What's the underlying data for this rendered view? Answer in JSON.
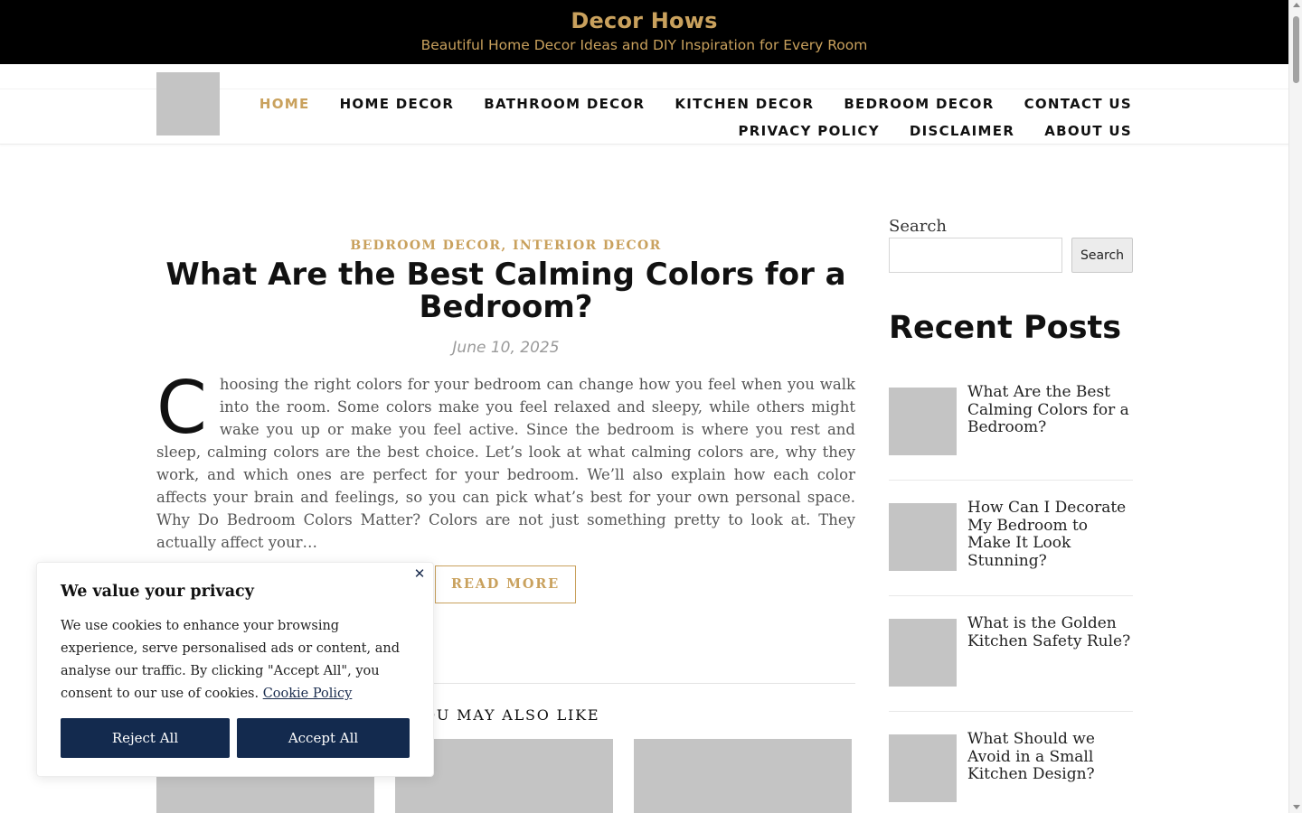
{
  "site": {
    "title": "Decor Hows",
    "tagline": "Beautiful Home Decor Ideas and DIY Inspiration for Every Room"
  },
  "nav": {
    "row1": [
      "HOME",
      "HOME DECOR",
      "BATHROOM DECOR",
      "KITCHEN DECOR",
      "BEDROOM DECOR",
      "CONTACT US"
    ],
    "row2": [
      "PRIVACY POLICY",
      "DISCLAIMER",
      "ABOUT US"
    ],
    "active": "HOME"
  },
  "post": {
    "categories": [
      "BEDROOM DECOR",
      "INTERIOR DECOR"
    ],
    "category_separator": ",",
    "title": "What Are the Best Calming Colors for a Bedroom?",
    "date": "June 10, 2025",
    "drop_cap": "C",
    "excerpt": "hoosing the right colors for your bedroom can change how you feel when you walk into the room. Some colors make you feel relaxed and sleepy, while others might wake you up or make you feel active. Since the bedroom is where you rest and sleep, calming colors are the best choice. Let’s look at what calming colors are, why they work, and which ones are perfect for your bedroom. We’ll also explain how each color affects your brain and feelings, so you can pick what’s best for your own personal space. Why Do Bedroom Colors Matter? Colors are not just something pretty to look at. They actually affect your…",
    "read_more": "READ MORE",
    "also_like": "YOU MAY ALSO LIKE"
  },
  "sidebar": {
    "search_label": "Search",
    "search_value": "",
    "search_button": "Search",
    "recent_heading": "Recent Posts",
    "recent_posts": [
      "What Are the Best Calming Colors for a Bedroom?",
      "How Can I Decorate My Bedroom to Make It Look Stunning?",
      "What is the Golden Kitchen Safety Rule?",
      "What Should we Avoid in a Small Kitchen Design?"
    ]
  },
  "cookie": {
    "title": "We value your privacy",
    "text": "We use cookies to enhance your browsing experience, serve personalised ads or content, and analyse our traffic. By clicking \"Accept All\", you consent to our use of cookies.",
    "link": "Cookie Policy",
    "reject": "Reject All",
    "accept": "Accept All",
    "close_glyph": "✕"
  },
  "colors": {
    "accent_gold": "#c9a15d",
    "banner_bg": "#000000",
    "button_navy": "#132a4e",
    "placeholder_gray": "#c4c4c4"
  }
}
